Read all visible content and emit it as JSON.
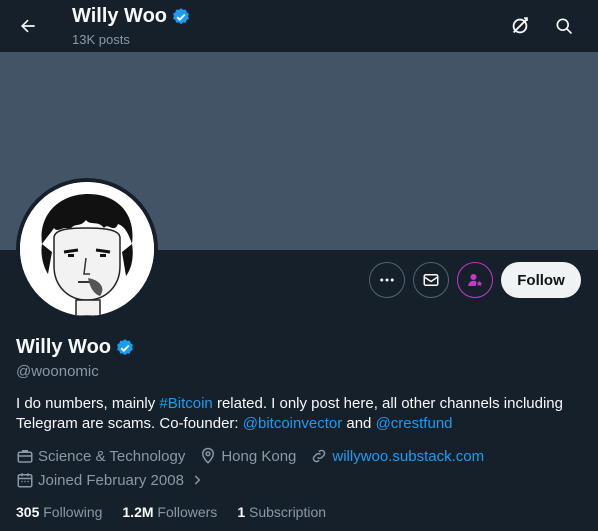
{
  "header": {
    "name": "Willy Woo",
    "posts": "13K posts"
  },
  "profile": {
    "display_name": "Willy Woo",
    "handle": "@woonomic",
    "follow_label": "Follow"
  },
  "bio": {
    "part1": "I do numbers, mainly ",
    "hashtag": "#Bitcoin",
    "part2": " related. I only post here, all other channels including Telegram are scams. Co-founder: ",
    "mention1": "@bitcoinvector",
    "part3": " and ",
    "mention2": "@crestfund"
  },
  "meta": {
    "category": "Science & Technology",
    "location": "Hong Kong",
    "website": "willywoo.substack.com",
    "joined": "Joined February 2008"
  },
  "stats": {
    "following_count": "305",
    "following_label": " Following",
    "followers_count": "1.2M",
    "followers_label": " Followers",
    "subscriptions_count": "1",
    "subscriptions_label": " Subscription"
  },
  "colors": {
    "background": "#15202b",
    "banner": "#425466",
    "accent": "#1d9bf0",
    "muted": "#8b98a5",
    "subscribe_accent": "#c936c9"
  },
  "icons": {
    "back": "arrow-left-icon",
    "grok": "grok-icon",
    "search": "search-icon",
    "verified": "verified-badge-icon",
    "more": "more-icon",
    "message": "envelope-icon",
    "subscribe": "subscribe-icon",
    "category": "briefcase-icon",
    "location": "location-pin-icon",
    "website": "link-icon",
    "joined": "calendar-icon"
  }
}
